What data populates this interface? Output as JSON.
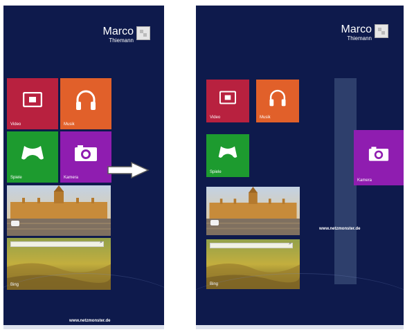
{
  "left_screen": {
    "user": {
      "first_name": "Marco",
      "last_name": "Thiemann"
    },
    "tiles": {
      "video": "Video",
      "musik": "Musik",
      "spiele": "Spiele",
      "kamera": "Kamera",
      "bing": "Bing"
    },
    "watermark": "www.netzmonster.de"
  },
  "right_screen": {
    "user": {
      "first_name": "Marco",
      "last_name": "Thiemann"
    },
    "tiles": {
      "video": "Video",
      "musik": "Musik",
      "spiele": "Spiele",
      "kamera": "Kamera",
      "bing": "Bing"
    },
    "watermark": "www.netzmonster.de"
  },
  "colors": {
    "background": "#0e1a4c",
    "video_tile": "#b8213f",
    "musik_tile": "#e1602a",
    "spiele_tile": "#1d9b2f",
    "kamera_tile": "#8f1db0"
  },
  "icons": {
    "video": "video-icon",
    "musik": "headphones-icon",
    "spiele": "gamepad-icon",
    "kamera": "camera-icon",
    "arrow": "arrow-right-icon"
  }
}
